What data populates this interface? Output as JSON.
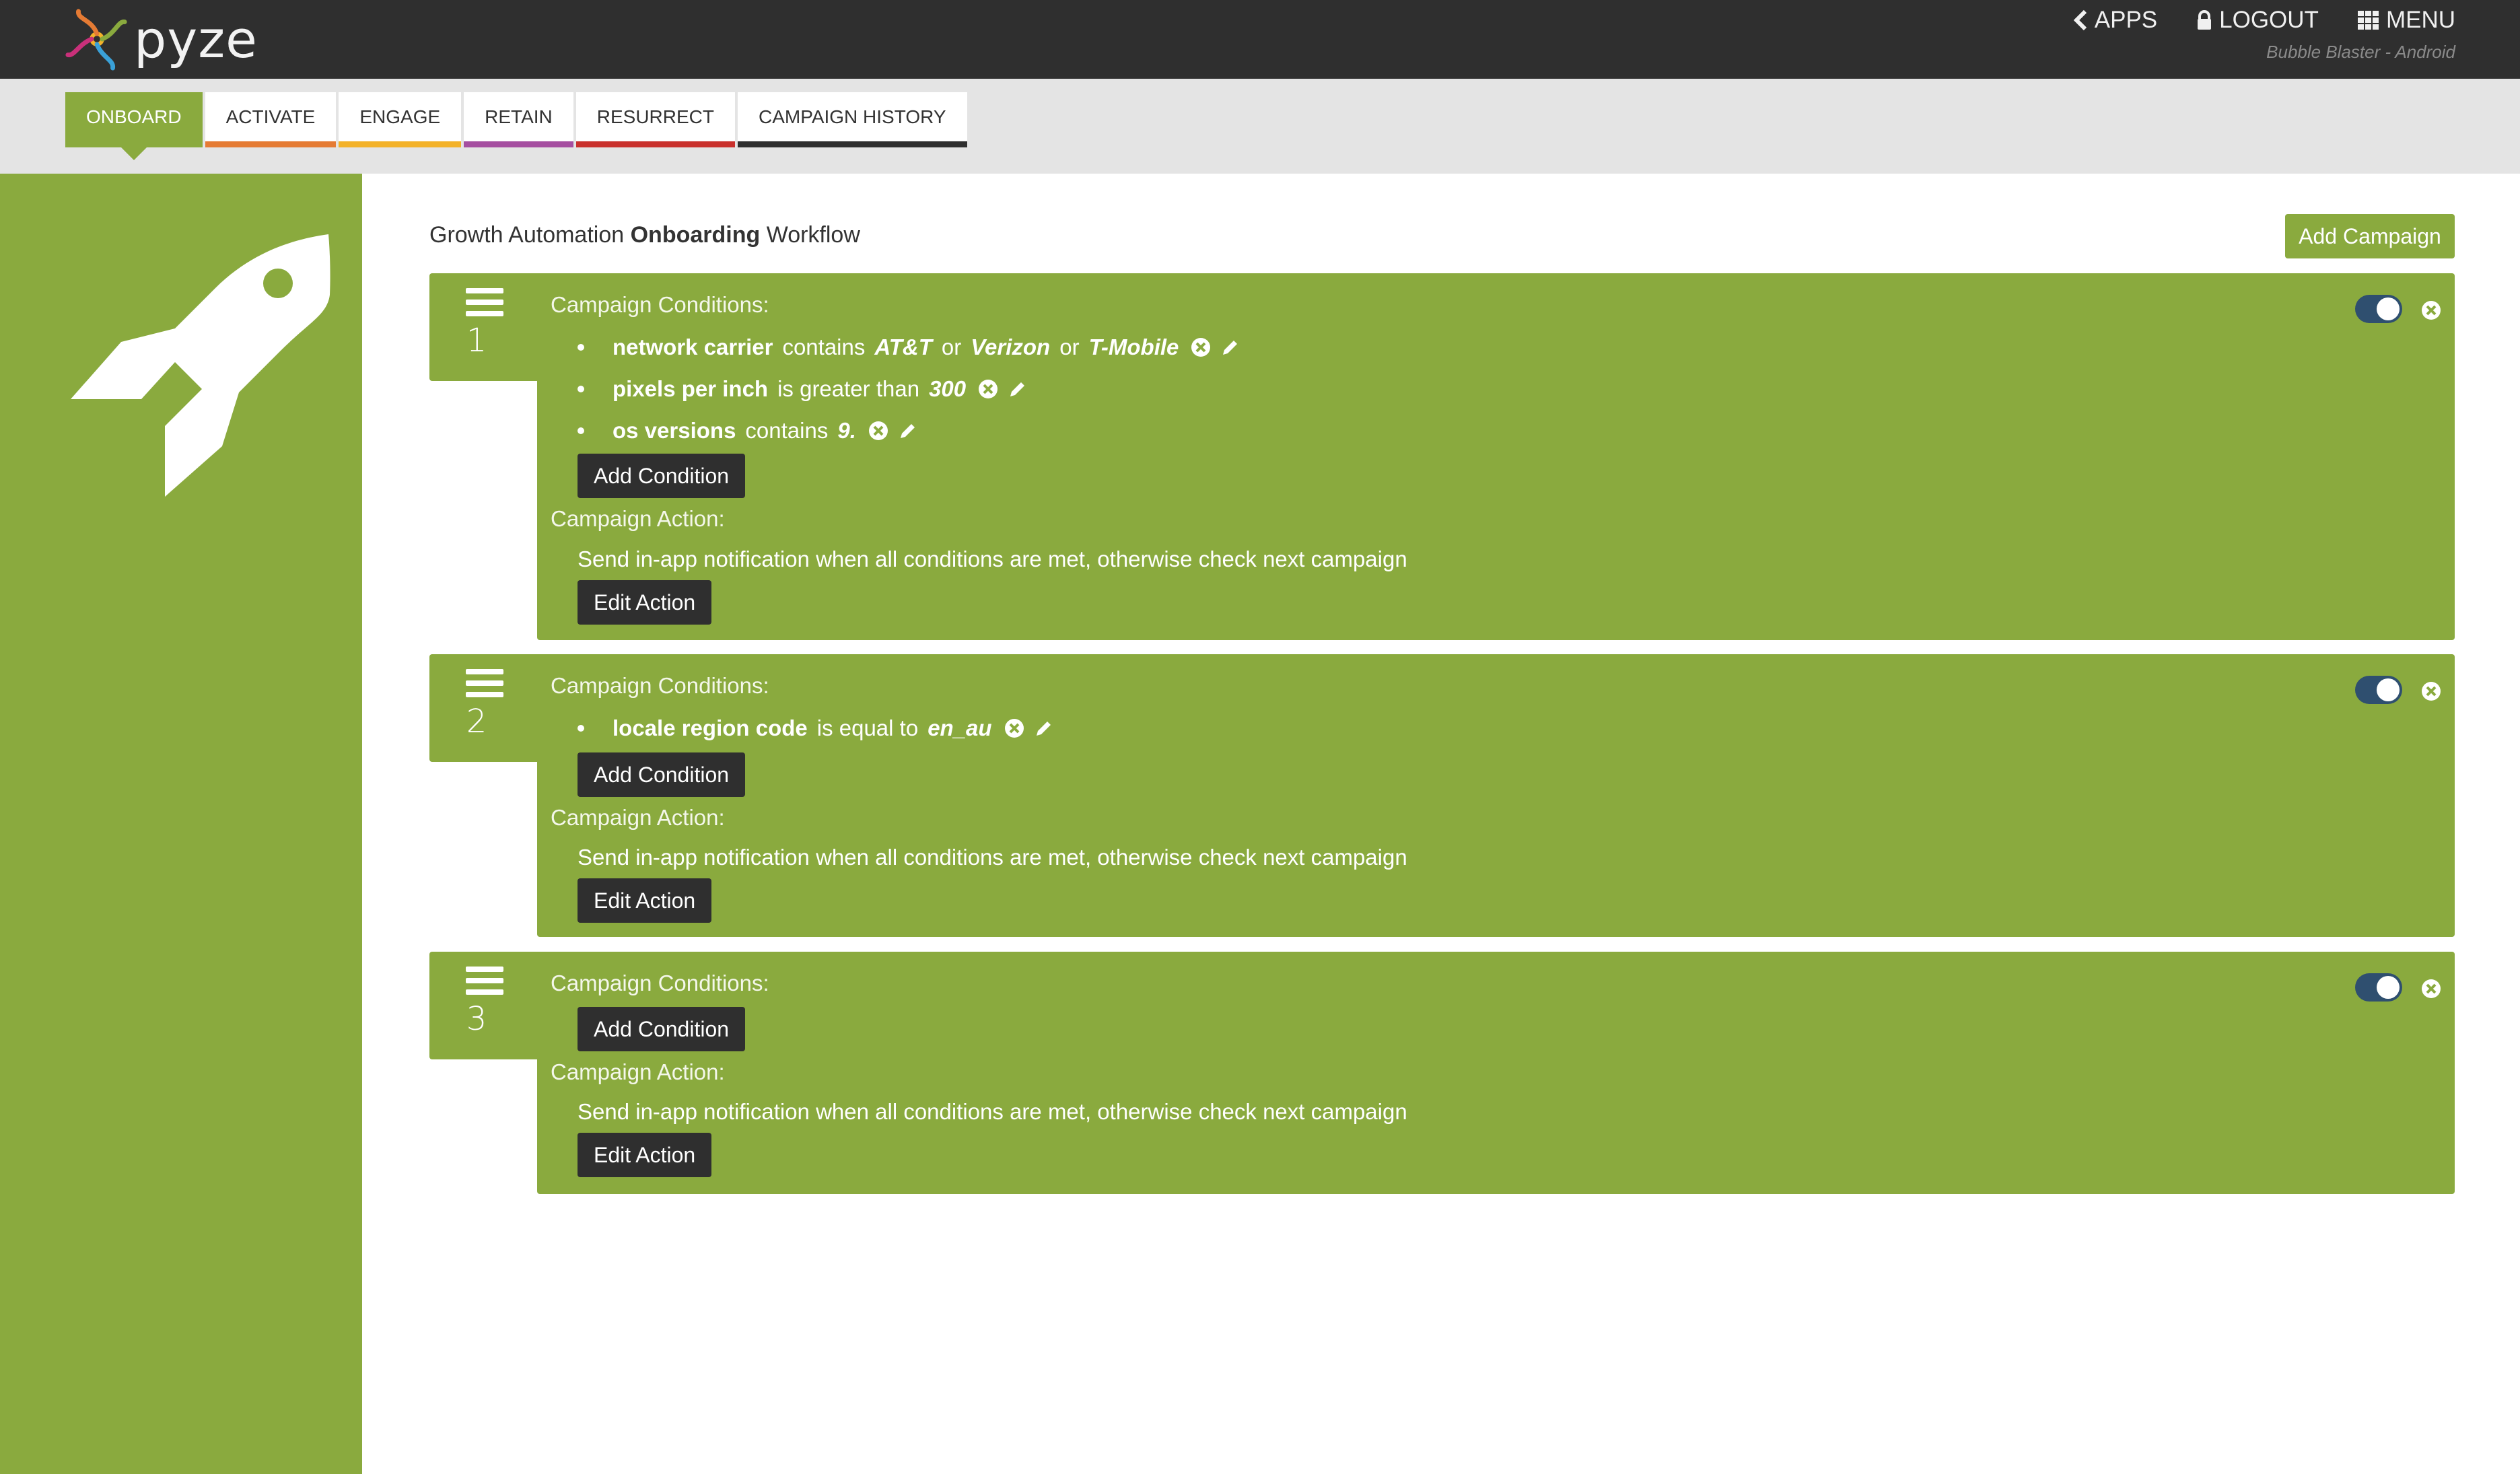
{
  "header": {
    "brand": "pyze",
    "nav": [
      {
        "label": "APPS",
        "icon": "chevron-left-icon"
      },
      {
        "label": "LOGOUT",
        "icon": "lock-icon"
      },
      {
        "label": "MENU",
        "icon": "grid-icon"
      }
    ],
    "app_name": "Bubble Blaster - Android"
  },
  "tabs": [
    {
      "label": "ONBOARD",
      "color": "#8aaa3e",
      "active": true
    },
    {
      "label": "ACTIVATE",
      "color": "#e57b34"
    },
    {
      "label": "ENGAGE",
      "color": "#f3b229"
    },
    {
      "label": "RETAIN",
      "color": "#a54ea0"
    },
    {
      "label": "RESURRECT",
      "color": "#c9302c"
    },
    {
      "label": "CAMPAIGN HISTORY",
      "color": "#2f2f2f"
    }
  ],
  "main": {
    "title_prefix": "Growth Automation ",
    "title_bold": "Onboarding",
    "title_suffix": " Workflow",
    "add_campaign": "Add Campaign"
  },
  "campaigns": [
    {
      "number": "1",
      "conditions_label": "Campaign Conditions:",
      "conditions": [
        {
          "field": "network carrier",
          "op": "contains",
          "values": [
            "AT&T",
            "Verizon",
            "T-Mobile"
          ],
          "joiner": "or"
        },
        {
          "field": "pixels per inch",
          "op": "is greater than",
          "values": [
            "300"
          ]
        },
        {
          "field": "os versions",
          "op": "contains",
          "values": [
            "9."
          ]
        }
      ],
      "add_condition": "Add Condition",
      "action_label": "Campaign Action:",
      "action_text": "Send in-app notification when all conditions are met, otherwise check next campaign",
      "edit_action": "Edit Action",
      "enabled": true
    },
    {
      "number": "2",
      "conditions_label": "Campaign Conditions:",
      "conditions": [
        {
          "field": "locale region code",
          "op": "is equal to",
          "values": [
            "en_au"
          ]
        }
      ],
      "add_condition": "Add Condition",
      "action_label": "Campaign Action:",
      "action_text": "Send in-app notification when all conditions are met, otherwise check next campaign",
      "edit_action": "Edit Action",
      "enabled": true
    },
    {
      "number": "3",
      "conditions_label": "Campaign Conditions:",
      "conditions": [],
      "add_condition": "Add Condition",
      "action_label": "Campaign Action:",
      "action_text": "Send in-app notification when all conditions are met, otherwise check next campaign",
      "edit_action": "Edit Action",
      "enabled": true
    }
  ]
}
